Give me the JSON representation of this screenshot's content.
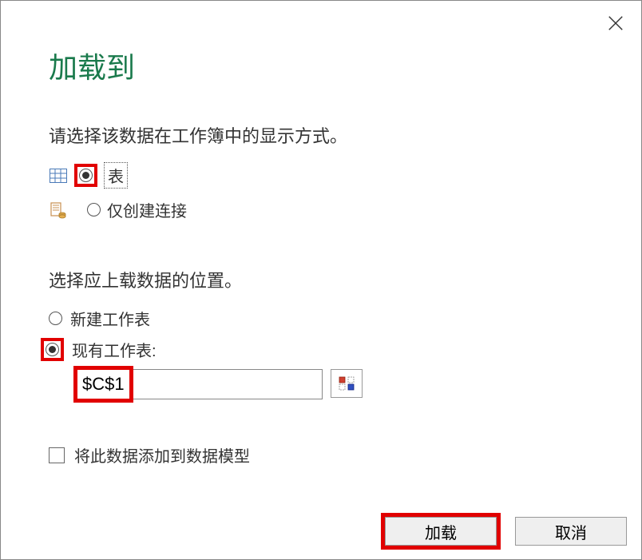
{
  "dialog": {
    "title": "加载到"
  },
  "display_section": {
    "label": "请选择该数据在工作簿中的显示方式。",
    "option_table": "表",
    "option_connection_only": "仅创建连接"
  },
  "location_section": {
    "label": "选择应上载数据的位置。",
    "option_new_sheet": "新建工作表",
    "option_existing_sheet": "现有工作表:",
    "cell_reference": "$C$1"
  },
  "data_model": {
    "checkbox_label": "将此数据添加到数据模型"
  },
  "buttons": {
    "load": "加载",
    "cancel": "取消"
  }
}
